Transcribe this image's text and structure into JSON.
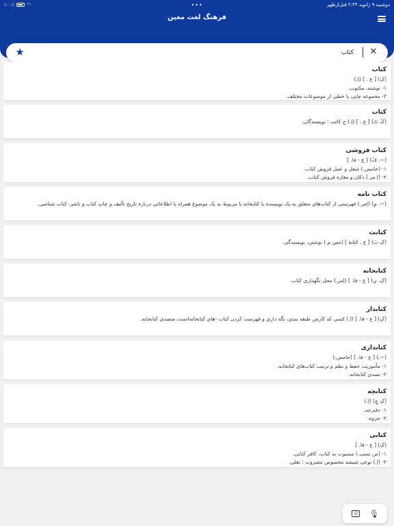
{
  "status": {
    "date_time": "دوشنبه ۹ ژانویه  ۲:۴۴ قبل‌ازظهر",
    "dots": "•••",
    "battery": "۱۰۰٪"
  },
  "header": {
    "title": "فرهنگ لغت معین"
  },
  "search": {
    "value": "کتاب"
  },
  "icons": {
    "menu": "menu-icon",
    "clear": "close-icon",
    "favorite": "star-icon",
    "mic": "microphone-icon",
    "emoji": "emoji-keyboard-icon"
  },
  "colors": {
    "primary": "#0d3a9c",
    "background": "#f0f0f2",
    "card": "#ffffff"
  },
  "results": [
    {
      "title": "کتاب",
      "lines": [
        "(کِ) [ ع . ] (اِ.)",
        "۱- نوشته، مکتوب.",
        "۲- مجموعه چاپی یا خطی از موضوعات مختلف."
      ]
    },
    {
      "title": "کتاب",
      "lines": [
        "(کُ تّ) [ ع . ] (اِ.) ج کاتب ؛ نویسندگان."
      ]
    },
    {
      "title": "کتاب فروشی",
      "lines": [
        "(~. فُ) [ ع - فا. ]",
        "۱- (حامص.) شغل و عمل فروش کتاب.",
        "۲- (اِ مر.) دکان و مغازه فروش کتاب."
      ]
    },
    {
      "title": "کتاب نامه",
      "lines": [
        "(~. مِ) (اِمر.) فهرستی از کتاب‌های متعلق به یک نویسنده یا کتابخانه یا مربوط به یک موضوع همراه با اطلاعاتی درباره تاریخ تألیف و چاپ کتاب و ناشر، کتاب شناسی."
      ]
    },
    {
      "title": "کتابت",
      "lines": [
        "(کِ بَ) [ ع . کتابة ] (مص م.) نوشتن، نویسندگی."
      ]
    },
    {
      "title": "کتابخانه",
      "lines": [
        "(کِ. نِ) [ ع - فا. ] (اِمر.) محل نگهداری کتاب."
      ]
    },
    {
      "title": "کتابدار",
      "lines": [
        "(کِ) [ ع - فا. ] (اِ.) کسی که کارش طبقه بندی، نگه داری و فهرست کردن کتاب  -های کتابخانه‌است، متصدی کتابخانه."
      ]
    },
    {
      "title": "کتابداری",
      "lines": [
        "(~.) [ ع - فا. ] (حامص.)",
        "۱- مأموریت حفظ و نظم و ترتیب کتاب‌های کتابخانه.",
        "۲- تصدی کتابخانه."
      ]
    },
    {
      "title": "کتابچه",
      "lines": [
        "(کِ چِ) (اِ.)",
        "۱- دفترچه.",
        "۲- جزوه."
      ]
    },
    {
      "title": "کتابی",
      "lines": [
        "(کِ) [ ع - فا. ]",
        "۱- (ص نسب.) منسوب به کتاب، کافر کتابی.",
        "۲- (اِ.) نوعی شیشه مخصوص مشروب ؛ بغلی."
      ]
    }
  ]
}
